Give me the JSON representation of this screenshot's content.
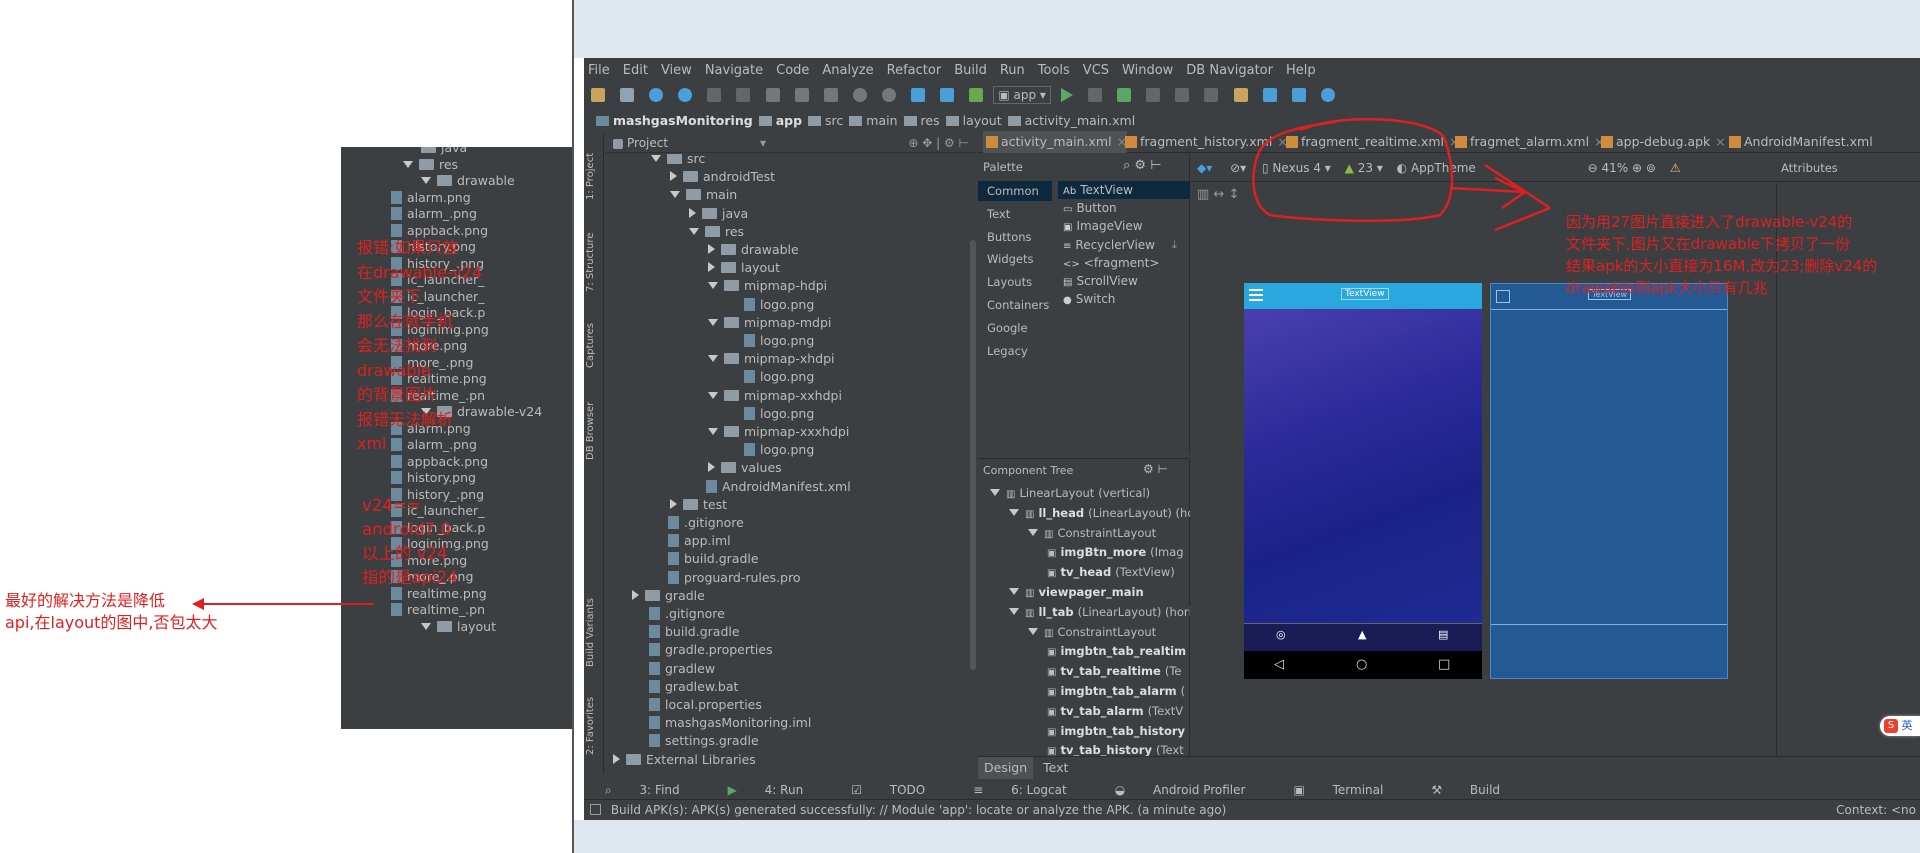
{
  "left_panel": {
    "items": [
      {
        "label": "java",
        "indent": 0,
        "type": "folder",
        "arrow": "none"
      },
      {
        "label": "res",
        "indent": 0,
        "type": "folder",
        "arrow": "down"
      },
      {
        "label": "drawable",
        "indent": 1,
        "type": "folder",
        "arrow": "down"
      },
      {
        "label": "alarm.png",
        "indent": 2,
        "type": "file"
      },
      {
        "label": "alarm_.png",
        "indent": 2,
        "type": "file"
      },
      {
        "label": "appback.png",
        "indent": 2,
        "type": "file"
      },
      {
        "label": "history.png",
        "indent": 2,
        "type": "file"
      },
      {
        "label": "history_.png",
        "indent": 2,
        "type": "file"
      },
      {
        "label": "ic_launcher_",
        "indent": 2,
        "type": "file"
      },
      {
        "label": "ic_launcher_",
        "indent": 2,
        "type": "file"
      },
      {
        "label": "login_back.p",
        "indent": 2,
        "type": "file"
      },
      {
        "label": "loginimg.png",
        "indent": 2,
        "type": "file"
      },
      {
        "label": "more.png",
        "indent": 2,
        "type": "file"
      },
      {
        "label": "more_.png",
        "indent": 2,
        "type": "file"
      },
      {
        "label": "realtime.png",
        "indent": 2,
        "type": "file"
      },
      {
        "label": "realtime_.pn",
        "indent": 2,
        "type": "file"
      },
      {
        "label": "drawable-v24",
        "indent": 1,
        "type": "folder",
        "arrow": "down"
      },
      {
        "label": "alarm.png",
        "indent": 2,
        "type": "file"
      },
      {
        "label": "alarm_.png",
        "indent": 2,
        "type": "file"
      },
      {
        "label": "appback.png",
        "indent": 2,
        "type": "file"
      },
      {
        "label": "history.png",
        "indent": 2,
        "type": "file"
      },
      {
        "label": "history_.png",
        "indent": 2,
        "type": "file"
      },
      {
        "label": "ic_launcher_",
        "indent": 2,
        "type": "file"
      },
      {
        "label": "login_back.p",
        "indent": 2,
        "type": "file"
      },
      {
        "label": "loginimg.png",
        "indent": 2,
        "type": "file"
      },
      {
        "label": "more.png",
        "indent": 2,
        "type": "file"
      },
      {
        "label": "more_.png",
        "indent": 2,
        "type": "file"
      },
      {
        "label": "realtime.png",
        "indent": 2,
        "type": "file"
      },
      {
        "label": "realtime_.pn",
        "indent": 2,
        "type": "file"
      },
      {
        "label": "layout",
        "indent": 1,
        "type": "folder",
        "arrow": "down"
      }
    ]
  },
  "annotations": {
    "error_note": [
      "报错:如果只放",
      "在drawable-v24",
      "文件夹下",
      "那么在就手机",
      "会无法找到",
      "drawable",
      "的背景图片",
      "报错无法解析",
      "xml"
    ],
    "v24_note": [
      "v24==",
      "android7.0",
      "以上的 v24",
      "指的是api24"
    ],
    "best_solution": [
      "最好的解决方法是降低",
      "api,在layout的图中,否包太大"
    ],
    "right_note": [
      "因为用27图片直接进入了drawable-v24的",
      "文件夹下,图片又在drawable下拷贝了一份",
      "结果apk的大小直接为16M,改为23;删除v24的",
      "drawable则apk大小只有几兆"
    ]
  },
  "menu": [
    "File",
    "Edit",
    "View",
    "Navigate",
    "Code",
    "Analyze",
    "Refactor",
    "Build",
    "Run",
    "Tools",
    "VCS",
    "Window",
    "DB Navigator",
    "Help"
  ],
  "toolbar": {
    "run_config": "app"
  },
  "breadcrumb": [
    "mashgasMonitoring",
    "app",
    "src",
    "main",
    "res",
    "layout",
    "activity_main.xml"
  ],
  "editor_tabs": [
    "activity_main.xml",
    "fragment_history.xml",
    "fragment_realtime.xml",
    "fragmet_alarm.xml",
    "app-debug.apk",
    "AndroidManifest.xml"
  ],
  "project_pane": {
    "title": "Project"
  },
  "project_tree": [
    {
      "label": "src",
      "indent": 2,
      "type": "folder",
      "arrow": "down"
    },
    {
      "label": "androidTest",
      "indent": 3,
      "type": "folder",
      "arrow": "right"
    },
    {
      "label": "main",
      "indent": 3,
      "type": "folder",
      "arrow": "down"
    },
    {
      "label": "java",
      "indent": 4,
      "type": "folder",
      "arrow": "right"
    },
    {
      "label": "res",
      "indent": 4,
      "type": "folder",
      "arrow": "down"
    },
    {
      "label": "drawable",
      "indent": 5,
      "type": "folder",
      "arrow": "right"
    },
    {
      "label": "layout",
      "indent": 5,
      "type": "folder",
      "arrow": "right"
    },
    {
      "label": "mipmap-hdpi",
      "indent": 5,
      "type": "folder",
      "arrow": "down"
    },
    {
      "label": "logo.png",
      "indent": 6,
      "type": "file"
    },
    {
      "label": "mipmap-mdpi",
      "indent": 5,
      "type": "folder",
      "arrow": "down"
    },
    {
      "label": "logo.png",
      "indent": 6,
      "type": "file"
    },
    {
      "label": "mipmap-xhdpi",
      "indent": 5,
      "type": "folder",
      "arrow": "down"
    },
    {
      "label": "logo.png",
      "indent": 6,
      "type": "file"
    },
    {
      "label": "mipmap-xxhdpi",
      "indent": 5,
      "type": "folder",
      "arrow": "down"
    },
    {
      "label": "logo.png",
      "indent": 6,
      "type": "file"
    },
    {
      "label": "mipmap-xxxhdpi",
      "indent": 5,
      "type": "folder",
      "arrow": "down"
    },
    {
      "label": "logo.png",
      "indent": 6,
      "type": "file"
    },
    {
      "label": "values",
      "indent": 5,
      "type": "folder",
      "arrow": "right"
    },
    {
      "label": "AndroidManifest.xml",
      "indent": 4,
      "type": "file"
    },
    {
      "label": "test",
      "indent": 3,
      "type": "folder",
      "arrow": "right"
    },
    {
      "label": ".gitignore",
      "indent": 2,
      "type": "file"
    },
    {
      "label": "app.iml",
      "indent": 2,
      "type": "file"
    },
    {
      "label": "build.gradle",
      "indent": 2,
      "type": "file"
    },
    {
      "label": "proguard-rules.pro",
      "indent": 2,
      "type": "file"
    },
    {
      "label": "gradle",
      "indent": 1,
      "type": "folder",
      "arrow": "right"
    },
    {
      "label": ".gitignore",
      "indent": 1,
      "type": "file"
    },
    {
      "label": "build.gradle",
      "indent": 1,
      "type": "file"
    },
    {
      "label": "gradle.properties",
      "indent": 1,
      "type": "file"
    },
    {
      "label": "gradlew",
      "indent": 1,
      "type": "file"
    },
    {
      "label": "gradlew.bat",
      "indent": 1,
      "type": "file"
    },
    {
      "label": "local.properties",
      "indent": 1,
      "type": "file"
    },
    {
      "label": "mashgasMonitoring.iml",
      "indent": 1,
      "type": "file"
    },
    {
      "label": "settings.gradle",
      "indent": 1,
      "type": "file"
    },
    {
      "label": "External Libraries",
      "indent": 0,
      "type": "folder",
      "arrow": "right"
    }
  ],
  "side_tools": [
    "1: Project",
    "7: Structure",
    "Captures",
    "DB Browser",
    "Build Variants",
    "2: Favorites"
  ],
  "palette": {
    "title": "Palette",
    "categories": [
      "Common",
      "Text",
      "Buttons",
      "Widgets",
      "Layouts",
      "Containers",
      "Google",
      "Legacy"
    ],
    "widgets": [
      "TextView",
      "Button",
      "ImageView",
      "RecyclerView",
      "<fragment>",
      "ScrollView",
      "Switch"
    ]
  },
  "design_toolbar": {
    "device": "Nexus 4",
    "api": "23",
    "theme": "AppTheme",
    "zoom": "41%",
    "attributes": "Attributes"
  },
  "component_tree": {
    "title": "Component Tree",
    "items": [
      {
        "label": "LinearLayout",
        "suffix": "(vertical)",
        "indent": 0
      },
      {
        "label": "ll_head",
        "suffix": "(LinearLayout) (hor",
        "indent": 1
      },
      {
        "label": "ConstraintLayout",
        "suffix": "",
        "indent": 2
      },
      {
        "label": "imgBtn_more",
        "suffix": "(Imag",
        "indent": 3
      },
      {
        "label": "tv_head",
        "suffix": "(TextView)",
        "indent": 3
      },
      {
        "label": "viewpager_main",
        "suffix": "",
        "indent": 1
      },
      {
        "label": "ll_tab",
        "suffix": "(LinearLayout) (horiz",
        "indent": 1
      },
      {
        "label": "ConstraintLayout",
        "suffix": "",
        "indent": 2
      },
      {
        "label": "imgbtn_tab_realtim",
        "suffix": "",
        "indent": 3
      },
      {
        "label": "tv_tab_realtime",
        "suffix": "(Te",
        "indent": 3
      },
      {
        "label": "imgbtn_tab_alarm",
        "suffix": "(",
        "indent": 3
      },
      {
        "label": "tv_tab_alarm",
        "suffix": "(TextV",
        "indent": 3
      },
      {
        "label": "imgbtn_tab_history",
        "suffix": "",
        "indent": 3
      },
      {
        "label": "tv_tab_history",
        "suffix": "(Text",
        "indent": 3
      }
    ]
  },
  "phone": {
    "header_text": "TextView"
  },
  "design_tabs": [
    "Design",
    "Text"
  ],
  "bottom_tools": [
    "3: Find",
    "4: Run",
    "TODO",
    "6: Logcat",
    "Android Profiler",
    "Terminal",
    "Build"
  ],
  "status": {
    "message": "Build APK(s): APK(s) generated successfully: // Module 'app': locate or analyze the APK. (a minute ago)",
    "context": "Context: <no"
  },
  "ime": {
    "label": "英"
  },
  "colors": {
    "ide_bg": "#3c3f41",
    "editor_bg": "#2b2b2b",
    "annotation_red": "#e02020",
    "phone_header": "#29a8e0",
    "selected": "#0d293e"
  }
}
